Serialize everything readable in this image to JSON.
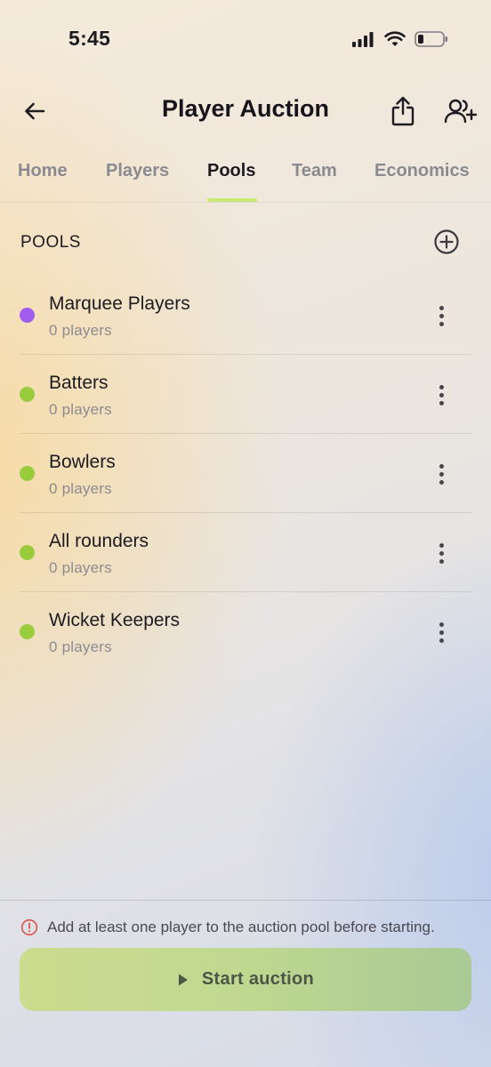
{
  "status_bar": {
    "time": "5:45"
  },
  "header": {
    "title": "Player Auction"
  },
  "tabs": [
    {
      "label": "Home",
      "active": false
    },
    {
      "label": "Players",
      "active": false
    },
    {
      "label": "Pools",
      "active": true
    },
    {
      "label": "Team",
      "active": false
    },
    {
      "label": "Economics",
      "active": false
    }
  ],
  "pools_section": {
    "title": "POOLS",
    "items": [
      {
        "name": "Marquee Players",
        "count": "0 players",
        "color": "#a25cf0"
      },
      {
        "name": "Batters",
        "count": "0 players",
        "color": "#98cc3c"
      },
      {
        "name": "Bowlers",
        "count": "0 players",
        "color": "#98cc3c"
      },
      {
        "name": "All rounders",
        "count": "0 players",
        "color": "#98cc3c"
      },
      {
        "name": "Wicket Keepers",
        "count": "0 players",
        "color": "#98cc3c"
      }
    ]
  },
  "footer": {
    "notice": "Add at least one player to the auction pool before starting.",
    "start_button_label": "Start auction"
  },
  "colors": {
    "accent": "#c6ea72",
    "warning": "#d9534f"
  }
}
